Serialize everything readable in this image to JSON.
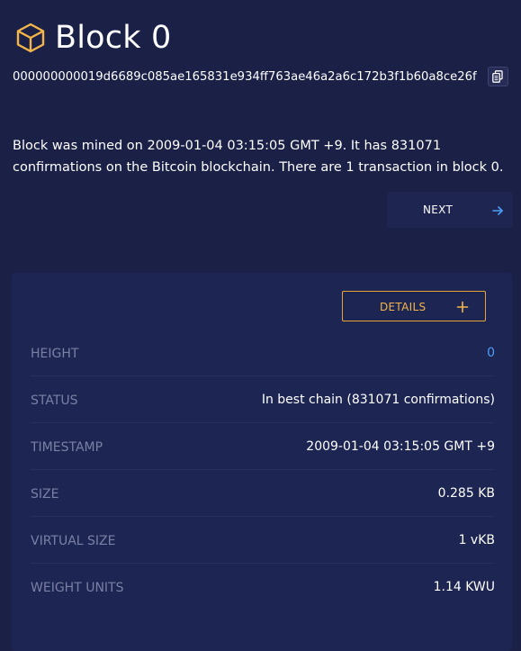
{
  "header": {
    "title": "Block 0",
    "icon": "cube-icon",
    "accent_color": "#f4b54a"
  },
  "block": {
    "hash": "000000000019d6689c085ae165831e934ff763ae46a2a6c172b3f1b60a8ce26f",
    "copy_icon": "copy-icon"
  },
  "description": "Block was mined on 2009-01-04 03:15:05 GMT +9. It has 831071 confirmations on the Bitcoin blockchain. There are 1 transaction in block 0.",
  "navigation": {
    "next_label": "NEXT",
    "next_icon": "arrow-right-icon"
  },
  "details": {
    "button_label": "DETAILS",
    "button_icon": "plus-icon",
    "button_color": "#e8a434",
    "rows": [
      {
        "label": "HEIGHT",
        "value": "0"
      },
      {
        "label": "STATUS",
        "value": "In best chain (831071 confirmations)"
      },
      {
        "label": "TIMESTAMP",
        "value": "2009-01-04 03:15:05 GMT +9"
      },
      {
        "label": "SIZE",
        "value": "0.285 KB"
      },
      {
        "label": "VIRTUAL SIZE",
        "value": "1 vKB"
      },
      {
        "label": "WEIGHT UNITS",
        "value": "1.14 KWU"
      }
    ]
  }
}
